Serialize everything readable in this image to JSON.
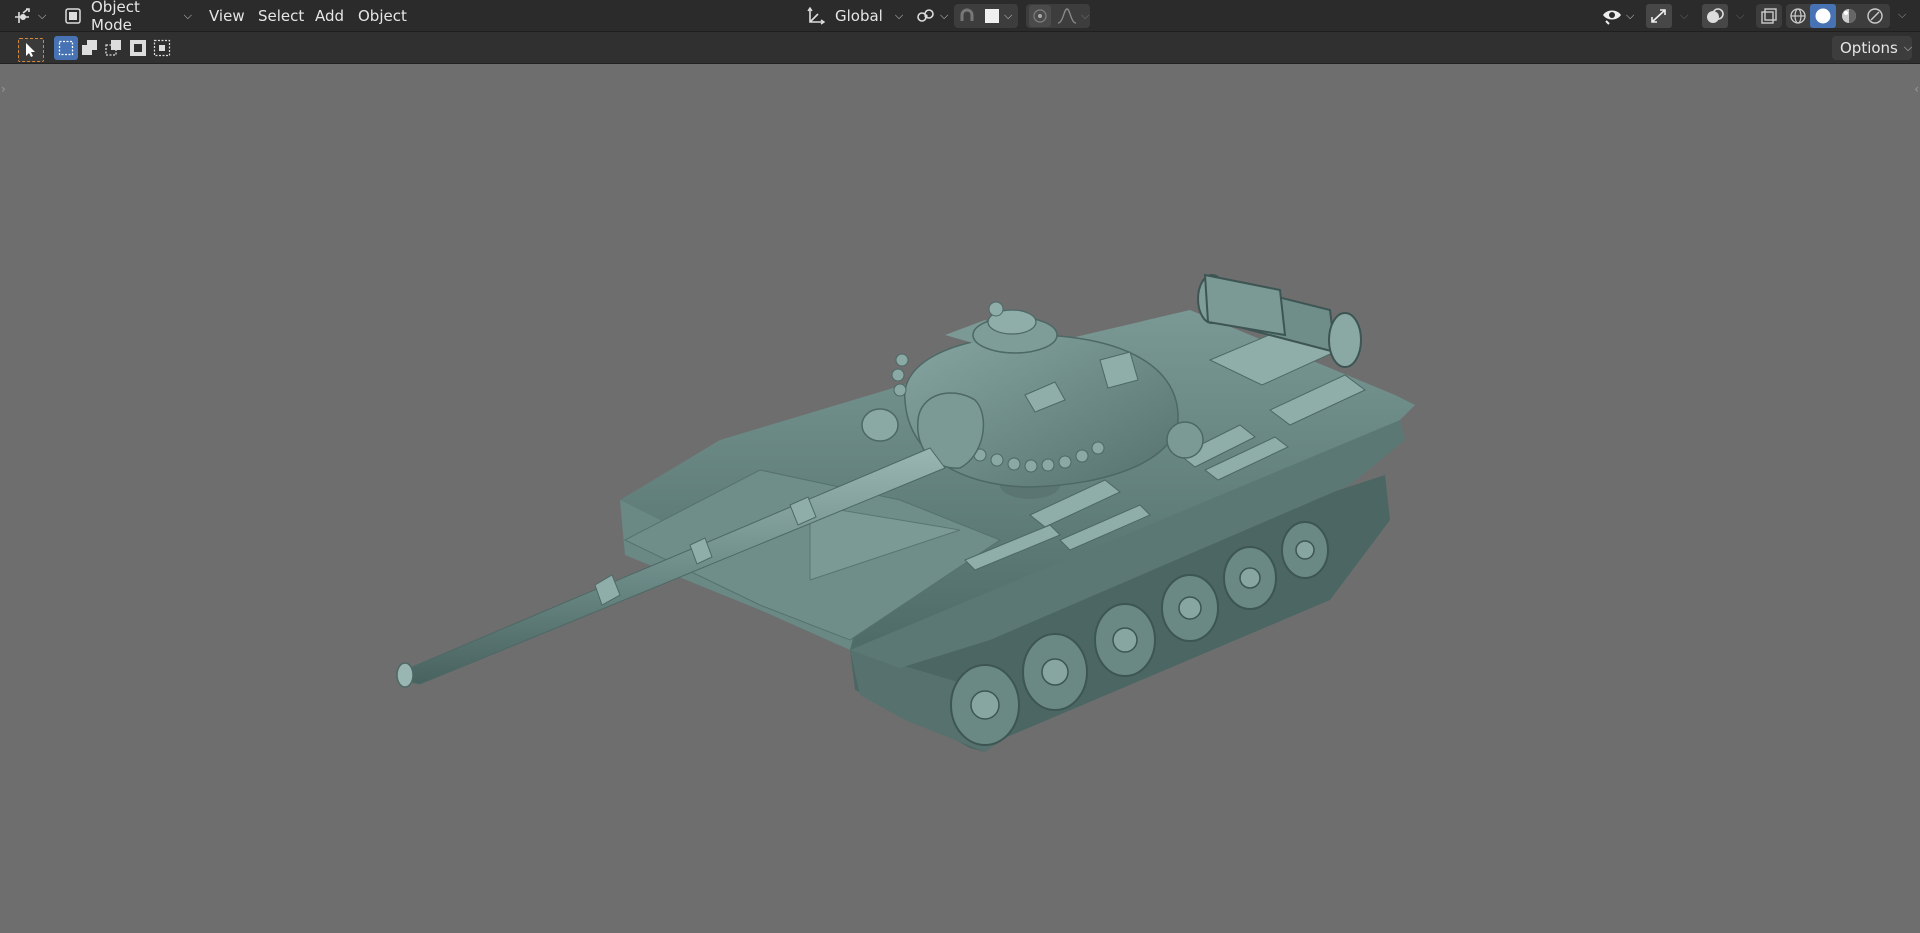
{
  "header": {
    "editor_type_icon": "viewport-gizmo-icon",
    "mode": {
      "label": "Object Mode",
      "icon": "object-mode-icon"
    },
    "menus": [
      "View",
      "Select",
      "Add",
      "Object"
    ],
    "transform_orientation": {
      "label": "Global",
      "icon": "orientation-axes-icon"
    },
    "pivot_icon": "pivot-links-icon",
    "snap_icon": "snap-magnet-icon",
    "snap_target_icon": "snap-square-icon",
    "proportional_icon": "proportional-editing-icon",
    "falloff_icon": "falloff-curve-icon",
    "visibility_icon": "eye-visibility-icon",
    "gizmo_icon": "gizmo-arrow-icon",
    "overlays_icon": "overlays-icon",
    "xray_icon": "xray-toggle-icon",
    "shading_modes": [
      "wireframe",
      "solid",
      "material-preview",
      "rendered"
    ],
    "active_shading": "solid"
  },
  "toolbar": {
    "select_tool_icon": "select-box-cursor-icon",
    "select_modes": [
      "select-new-icon",
      "select-extend-icon",
      "select-subtract-icon",
      "select-invert-icon",
      "select-intersect-icon"
    ],
    "options_label": "Options"
  },
  "viewport": {
    "background_color": "#6e6e6e",
    "model": "tank-model",
    "model_color": "#5f7d79"
  }
}
